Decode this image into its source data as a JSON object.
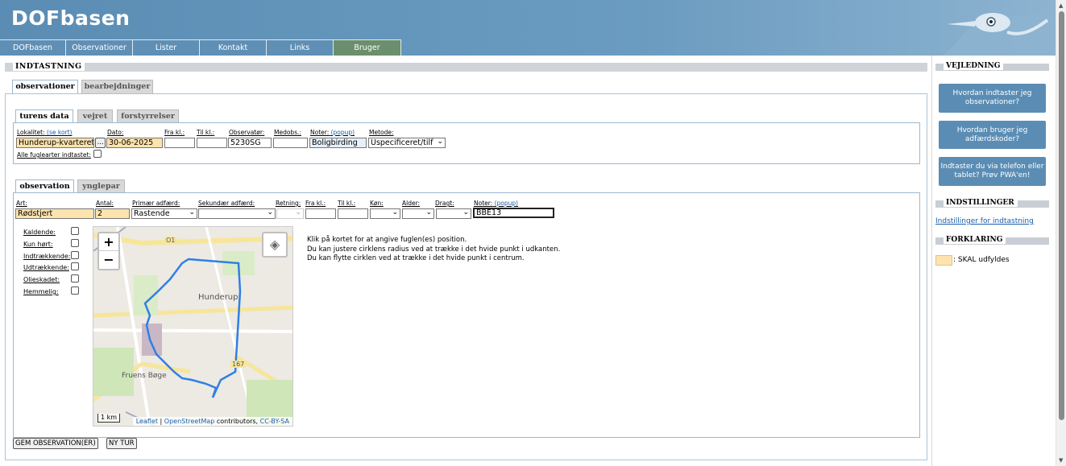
{
  "app": {
    "title": "DOFbasen"
  },
  "nav": [
    {
      "label": "DOFbasen"
    },
    {
      "label": "Observationer"
    },
    {
      "label": "Lister"
    },
    {
      "label": "Kontakt"
    },
    {
      "label": "Links"
    },
    {
      "label": "Bruger"
    }
  ],
  "main": {
    "section_title": "INDTASTNING",
    "tabs": [
      {
        "label": "observationer"
      },
      {
        "label": "bearbejdninger"
      }
    ],
    "subtabs": [
      {
        "label": "turens data"
      },
      {
        "label": "vejret"
      },
      {
        "label": "forstyrrelser"
      }
    ],
    "trip": {
      "lokalitet_label": "Lokalitet:",
      "lokalitet_link": "(se kort)",
      "lokalitet_value": "Hunderup-kvarteret,",
      "dots": "...",
      "dato_label": "Dato:",
      "dato_value": "30-06-2025",
      "frakl_label": "Fra kl.:",
      "frakl_value": "",
      "tilkl_label": "Til kl.:",
      "tilkl_value": "",
      "observator_label": "Observatør:",
      "observator_value": "5230SG",
      "medobs_label": "Medobs.:",
      "medobs_value": "",
      "noter_label": "Noter:",
      "noter_link": "(popup)",
      "noter_value": "Boligbirding",
      "metode_label": "Metode:",
      "metode_value": "Uspecificeret/tilf",
      "alle_label": "Alle fuglearter indtastet:"
    },
    "obstabs": [
      {
        "label": "observation"
      },
      {
        "label": "ynglepar"
      }
    ],
    "obs": {
      "art_label": "Art:",
      "art_value": "Rødstjert",
      "antal_label": "Antal:",
      "antal_value": "2",
      "primaer_label": "Primær adfærd:",
      "primaer_value": "Rastende",
      "sekundaer_label": "Sekundær adfærd:",
      "sekundaer_value": "",
      "retning_label": "Retning:",
      "frakl_label": "Fra kl.:",
      "tilkl_label": "Til kl.:",
      "kon_label": "Køn:",
      "alder_label": "Alder:",
      "dragt_label": "Dragt:",
      "noter_label": "Noter:",
      "noter_link": "(popup)",
      "noter_value": "BBE13"
    },
    "flags": [
      {
        "label": "Kaldende:"
      },
      {
        "label": "Kun hørt:"
      },
      {
        "label": "Indtrækkende:"
      },
      {
        "label": "Udtrækkende:"
      },
      {
        "label": "Olieskadet:"
      },
      {
        "label": "Hemmelig:"
      }
    ],
    "map": {
      "zoom_in": "+",
      "zoom_out": "−",
      "place1": "Hunderup",
      "place2": "Fruens Bøge",
      "road": "O1",
      "road2": "167",
      "scale": "1 km",
      "attribution_leaflet": "Leaflet",
      "attribution_sep": "|",
      "attribution_osm": "OpenStreetMap",
      "attribution_contrib": "contributors,",
      "attribution_license": "CC-BY-SA"
    },
    "map_help": [
      "Klik på kortet for at angive fuglen(es) position.",
      "Du kan justere cirklens radius ved at trække i det hvide punkt i udkanten.",
      "Du kan flytte cirklen ved at trække i det hvide punkt i centrum."
    ],
    "buttons": {
      "save": "GEM OBSERVATION(ER)",
      "new_trip": "NY TUR"
    }
  },
  "right": {
    "guide_title": "VEJLEDNING",
    "guide_buttons": [
      {
        "label": "Hvordan indtaster jeg observationer?"
      },
      {
        "label": "Hvordan bruger jeg adfærdskoder?"
      },
      {
        "label": "Indtaster du via telefon eller tablet? Prøv PWA'en!"
      }
    ],
    "settings_title": "INDSTILLINGER",
    "settings_link": "Indstillinger for indtastning",
    "legend_title": "FORKLARING",
    "legend_text": ": SKAL udfyldes"
  },
  "colors": {
    "header": "#5b8db4",
    "required": "#fde3ad",
    "active_nav": "#6b8f6c",
    "guide_button": "#5b8db4"
  }
}
